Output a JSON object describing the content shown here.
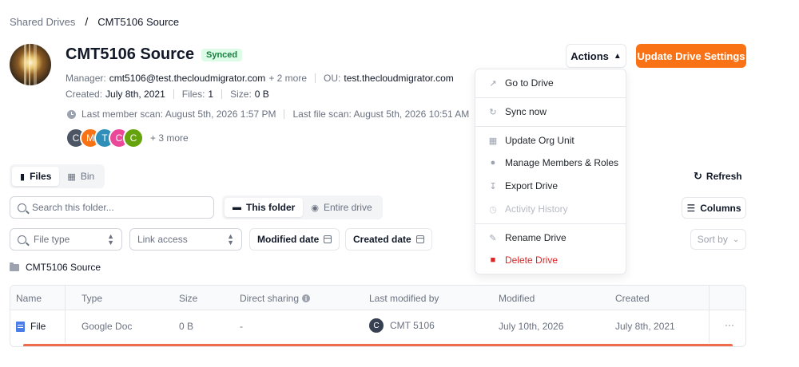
{
  "breadcrumb": {
    "root": "Shared Drives",
    "separator": "/",
    "current": "CMT5106 Source"
  },
  "drive": {
    "name": "CMT5106 Source",
    "status": "Synced",
    "manager_label": "Manager:",
    "manager": "cmt5106@test.thecloudmigrator.com",
    "manager_more": "+ 2 more",
    "ou_label": "OU:",
    "ou": "test.thecloudmigrator.com",
    "created_label": "Created:",
    "created": "July 8th, 2021",
    "files_label": "Files:",
    "files": "1",
    "size_label": "Size:",
    "size": "0 B",
    "last_member_scan": "Last member scan: August 5th, 2026 1:57 PM",
    "last_file_scan": "Last file scan: August 5th, 2026 10:51 AM",
    "members": [
      {
        "initial": "C",
        "color": "#4b5563"
      },
      {
        "initial": "M",
        "color": "#f97316"
      },
      {
        "initial": "T",
        "color": "#2f8fb8"
      },
      {
        "initial": "C",
        "color": "#ec4899"
      },
      {
        "initial": "C",
        "color": "#65a30d"
      }
    ],
    "members_more": "+ 3 more"
  },
  "header_buttons": {
    "actions": "Actions",
    "update": "Update Drive Settings"
  },
  "actions_menu": {
    "go_to_drive": "Go to Drive",
    "sync_now": "Sync now",
    "update_org_unit": "Update Org Unit",
    "manage_members": "Manage Members & Roles",
    "export_drive": "Export Drive",
    "activity_history": "Activity History",
    "rename_drive": "Rename Drive",
    "delete_drive": "Delete Drive"
  },
  "tabs": {
    "files": "Files",
    "bin": "Bin"
  },
  "toolbar": {
    "refresh": "Refresh",
    "search_placeholder": "Search this folder...",
    "this_folder": "This folder",
    "entire_drive": "Entire drive",
    "columns": "Columns",
    "file_type": "File type",
    "link_access": "Link access",
    "modified_date": "Modified date",
    "created_date": "Created date",
    "sort_by": "Sort by"
  },
  "current_folder": "CMT5106 Source",
  "table": {
    "headers": {
      "name": "Name",
      "type": "Type",
      "size": "Size",
      "direct_sharing": "Direct sharing",
      "last_modified_by": "Last modified by",
      "modified": "Modified",
      "created": "Created"
    },
    "rows": [
      {
        "name": "File",
        "type": "Google Doc",
        "size": "0 B",
        "direct_sharing": "-",
        "modifier_initial": "C",
        "modifier": "CMT 5106",
        "modified": "July 10th, 2026",
        "created": "July 8th, 2021",
        "menu": "···"
      }
    ]
  }
}
